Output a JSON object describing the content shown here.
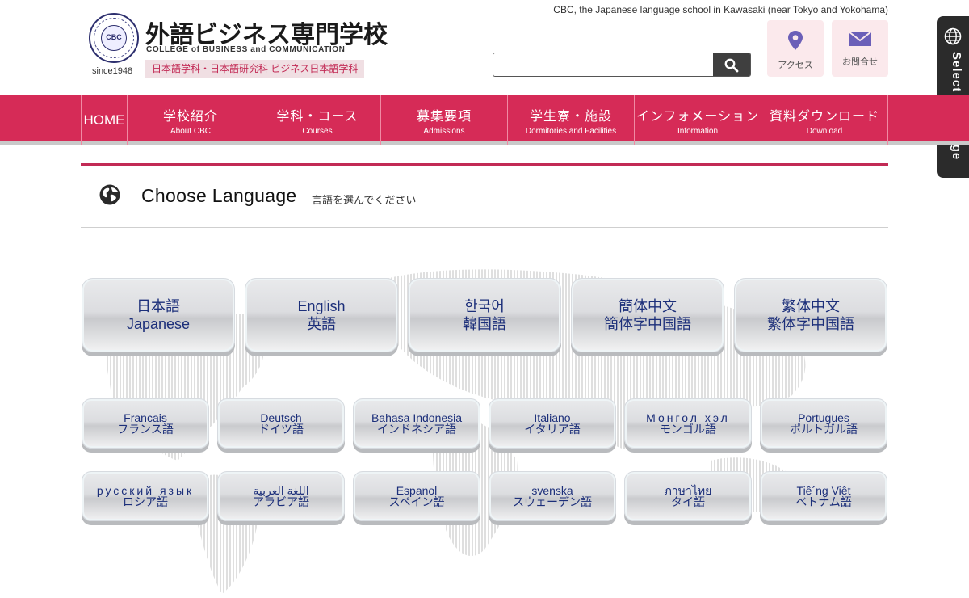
{
  "header": {
    "tagline": "CBC, the Japanese language school in Kawasaki (near Tokyo and Yokohama)",
    "seal_text": "CBC",
    "since": "since1948",
    "school_name_jp": "外語ビジネス専門学校",
    "school_name_en": "COLLEGE of BUSINESS and COMMUNICATION",
    "departments": "日本語学科・日本語研究科 ビジネス日本語学科",
    "search": {
      "value": "",
      "placeholder": ""
    },
    "quick_links": [
      {
        "label": "アクセス",
        "icon": "map-pin-icon"
      },
      {
        "label": "お問合せ",
        "icon": "mail-icon"
      }
    ]
  },
  "nav": [
    {
      "main": "HOME",
      "sub": ""
    },
    {
      "main": "学校紹介",
      "sub": "About CBC"
    },
    {
      "main": "学科・コース",
      "sub": "Courses"
    },
    {
      "main": "募集要項",
      "sub": "Admissions"
    },
    {
      "main": "学生寮・施設",
      "sub": "Dormitories and Facilities"
    },
    {
      "main": "インフォメーション",
      "sub": "Information"
    },
    {
      "main": "資料ダウンロード",
      "sub": "Download"
    }
  ],
  "side_tab": {
    "label": "Select Language",
    "icon": "globe-icon"
  },
  "page": {
    "title": "Choose Language",
    "subtitle": "言語を選んでください"
  },
  "languages_major": [
    {
      "line1": "日本語",
      "line2": "Japanese"
    },
    {
      "line1": "English",
      "line2": "英語"
    },
    {
      "line1": "한국어",
      "line2": "韓国語"
    },
    {
      "line1": "簡体中文",
      "line2": "簡体字中国語"
    },
    {
      "line1": "繁体中文",
      "line2": "繁体字中国語"
    }
  ],
  "languages_row2": [
    {
      "line1": "Francais",
      "line2": "フランス語"
    },
    {
      "line1": "Deutsch",
      "line2": "ドイツ語"
    },
    {
      "line1": "Bahasa Indonesia",
      "line2": "インドネシア語"
    },
    {
      "line1": "Italiano",
      "line2": "イタリア語"
    },
    {
      "line1": "Монгол хэл",
      "line2": "モンゴル語"
    },
    {
      "line1": "Portugues",
      "line2": "ポルトガル語"
    }
  ],
  "languages_row3": [
    {
      "line1": "русский язык",
      "line2": "ロシア語"
    },
    {
      "line1": "اللغة العربية",
      "line2": "アラビア語"
    },
    {
      "line1": "Espanol",
      "line2": "スペイン語"
    },
    {
      "line1": "svenska",
      "line2": "スウェーデン語"
    },
    {
      "line1": "ภาษาไทย",
      "line2": "タイ語"
    },
    {
      "line1": "Tiê´ng Viêt",
      "line2": "ベトナム語"
    }
  ],
  "colors": {
    "brand": "#d62b57",
    "button_text": "#1c2f7a",
    "side_tab": "#2b2b2b"
  }
}
